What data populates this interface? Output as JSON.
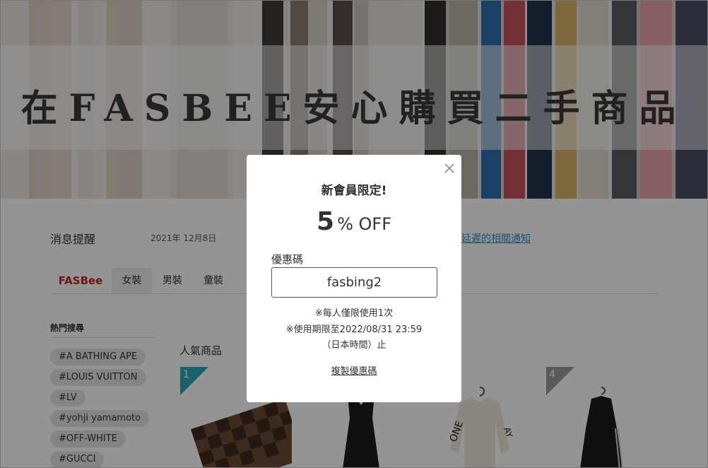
{
  "hero": {
    "title": "在FASBEE安心購買二手商品"
  },
  "news": {
    "label": "消息提醒",
    "date": "2021年 12月8日",
    "link": "延遲的相關通知"
  },
  "tabs": [
    {
      "label": "FASBee"
    },
    {
      "label": "女裝"
    },
    {
      "label": "男裝"
    },
    {
      "label": "童裝"
    }
  ],
  "hot_search": {
    "title": "熱門搜尋",
    "tags": [
      "#A BATHING APE",
      "#LOUIS VUITTON",
      "#LV",
      "#yohji yamamoto",
      "#OFF-WHITE",
      "#GUCCI"
    ]
  },
  "popular": {
    "title": "人氣商品",
    "ranks": [
      "1",
      "4"
    ]
  },
  "modal": {
    "title": "新會員限定!",
    "offer_number": "5",
    "offer_text": "% OFF",
    "code_label": "優惠碼",
    "code": "fasbing2",
    "note1": "※每人僅限使用1次",
    "note2": "※使用期限至2022/08/31 23:59",
    "note3": "（日本時間）止",
    "copy_label": "複製優惠碼"
  },
  "colors": {
    "brand_red": "#c8231c",
    "rank_teal": "#2aa9b8",
    "link_blue": "#2a8fbf"
  }
}
